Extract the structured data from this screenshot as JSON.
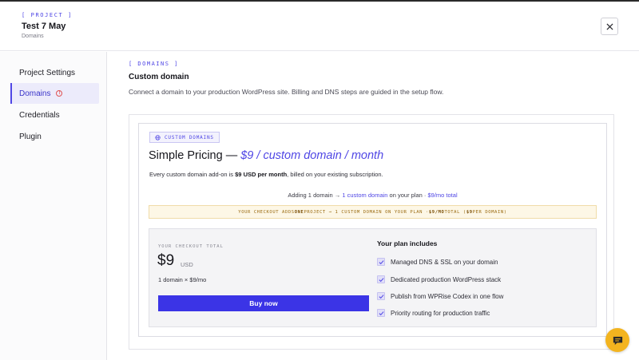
{
  "header": {
    "project_tag": "[ PROJECT ]",
    "title": "Test 7 May",
    "subtitle": "Domains",
    "close_icon": "close-icon"
  },
  "sidebar": {
    "items": [
      {
        "label": "Project Settings",
        "active": false
      },
      {
        "label": "Domains",
        "active": true,
        "icon": "warning-icon",
        "icon_glyph": "!"
      },
      {
        "label": "Credentials",
        "active": false
      },
      {
        "label": "Plugin",
        "active": false
      }
    ]
  },
  "main": {
    "section_tag": "[ DOMAINS ]",
    "title": "Custom domain",
    "description": "Connect a domain to your production WordPress site. Billing and DNS steps are guided in the setup flow."
  },
  "pricing": {
    "badge": "CUSTOM DOMAINS",
    "badge_icon": "globe-icon",
    "title_plain": "Simple Pricing — ",
    "title_highlight": "$9 / custom domain / month",
    "desc_prefix": "Every custom domain add-on is ",
    "desc_bold": "$9 USD per month",
    "desc_suffix": ", billed on your existing subscription.",
    "adding_prefix": "Adding 1 domain → ",
    "adding_link": "1 custom domain",
    "adding_middle": " on your plan · ",
    "adding_total": "$9/mo total",
    "notice_prefix": "YOUR CHECKOUT ADDS ",
    "notice_bold1": "ONE",
    "notice_middle": " PROJECT → 1 CUSTOM DOMAIN ON YOUR PLAN · ",
    "notice_bold2": "$9/MO",
    "notice_after2": " TOTAL (",
    "notice_bold3": "$9",
    "notice_suffix": " PER DOMAIN)"
  },
  "checkout": {
    "label": "YOUR CHECKOUT TOTAL",
    "price": "$9",
    "unit": "USD",
    "sub": "1 domain × $9/mo",
    "button": "Buy now"
  },
  "plan": {
    "title": "Your plan includes",
    "items": [
      "Managed DNS & SSL on your domain",
      "Dedicated production WordPress stack",
      "Publish from WPRise Codex in one flow",
      "Priority routing for production traffic"
    ]
  },
  "chat": {
    "icon": "chat-icon"
  },
  "colors": {
    "accent": "#4f46e5",
    "button": "#3b34e6",
    "notice_bg": "#fdf7e6",
    "notice_text": "#9a6a10",
    "chat_fab": "#f3b41f",
    "warning": "#e05252"
  }
}
